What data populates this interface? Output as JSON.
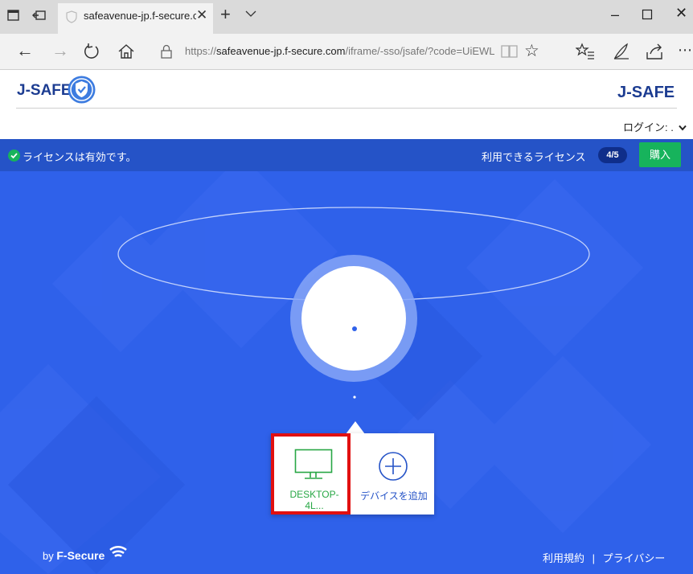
{
  "browser": {
    "tab_title": "safeavenue-jp.f-secure.c",
    "url_prefix": "https://",
    "url_host": "safeavenue-jp.f-secure.com",
    "url_path": "/iframe/-sso/jsafe/?code=UiEWL"
  },
  "header": {
    "brand_left": "J-SAFE",
    "brand_right": "J-SAFE",
    "login": "ログイン: ."
  },
  "status": {
    "message": "ライセンスは有効です。",
    "licenses_label": "利用できるライセンス",
    "licenses_count": "4/5",
    "buy_label": "購入",
    "ok_color": "#17b35c"
  },
  "devices": {
    "current_device": "DESKTOP-4L...",
    "add_device": "デバイスを追加"
  },
  "footer": {
    "by": "by",
    "brand": "F-Secure",
    "terms": "利用規約",
    "separator": "|",
    "privacy": "プライバシー"
  },
  "colors": {
    "stage_blue": "#2f61ea",
    "bar_blue": "#2553c7",
    "brand_navy": "#1c3c91",
    "highlight_red": "#e11010"
  }
}
